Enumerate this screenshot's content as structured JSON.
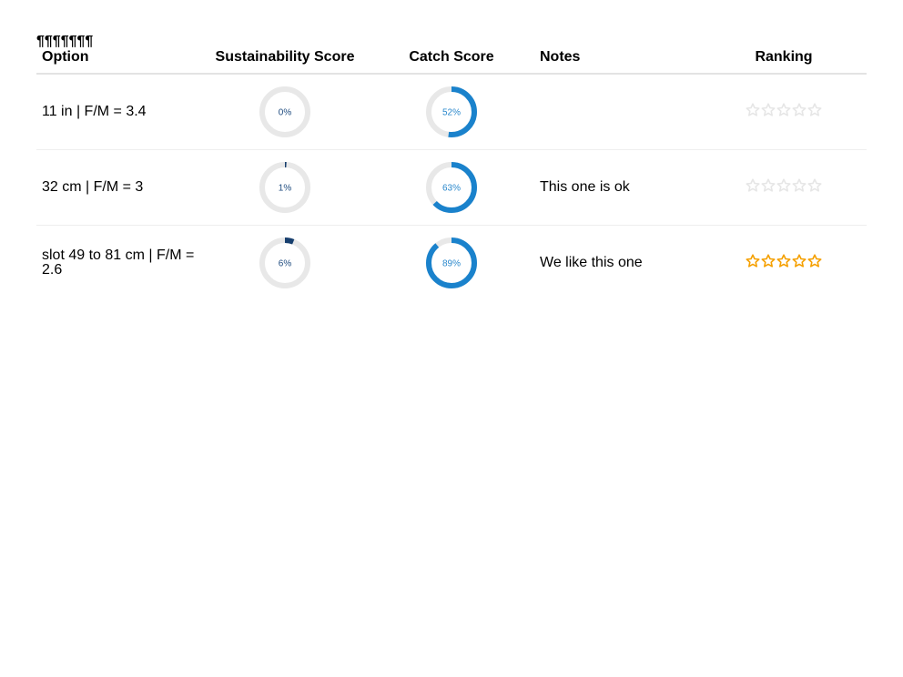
{
  "pilcrows": "¶¶¶¶¶¶¶",
  "headers": {
    "option": "Option",
    "sustainability": "Sustainability Score",
    "catch": "Catch Score",
    "notes": "Notes",
    "ranking": "Ranking"
  },
  "colors": {
    "sustainability": "#173f6e",
    "catch": "#1a82cc",
    "track": "#e8e8e8",
    "star_on": "#f5a000",
    "star_off": "#e6e6e6"
  },
  "rows": [
    {
      "option": "11 in | F/M = 3.4",
      "sustainability": 0,
      "sustainability_label": "0%",
      "catch": 52,
      "catch_label": "52%",
      "notes": "",
      "ranking": 0
    },
    {
      "option": "32 cm | F/M = 3",
      "sustainability": 1,
      "sustainability_label": "1%",
      "catch": 63,
      "catch_label": "63%",
      "notes": "This one is ok",
      "ranking": 0
    },
    {
      "option": "slot 49 to 81 cm | F/M = 2.6",
      "sustainability": 6,
      "sustainability_label": "6%",
      "catch": 89,
      "catch_label": "89%",
      "notes": "We like this one",
      "ranking": 5
    }
  ]
}
